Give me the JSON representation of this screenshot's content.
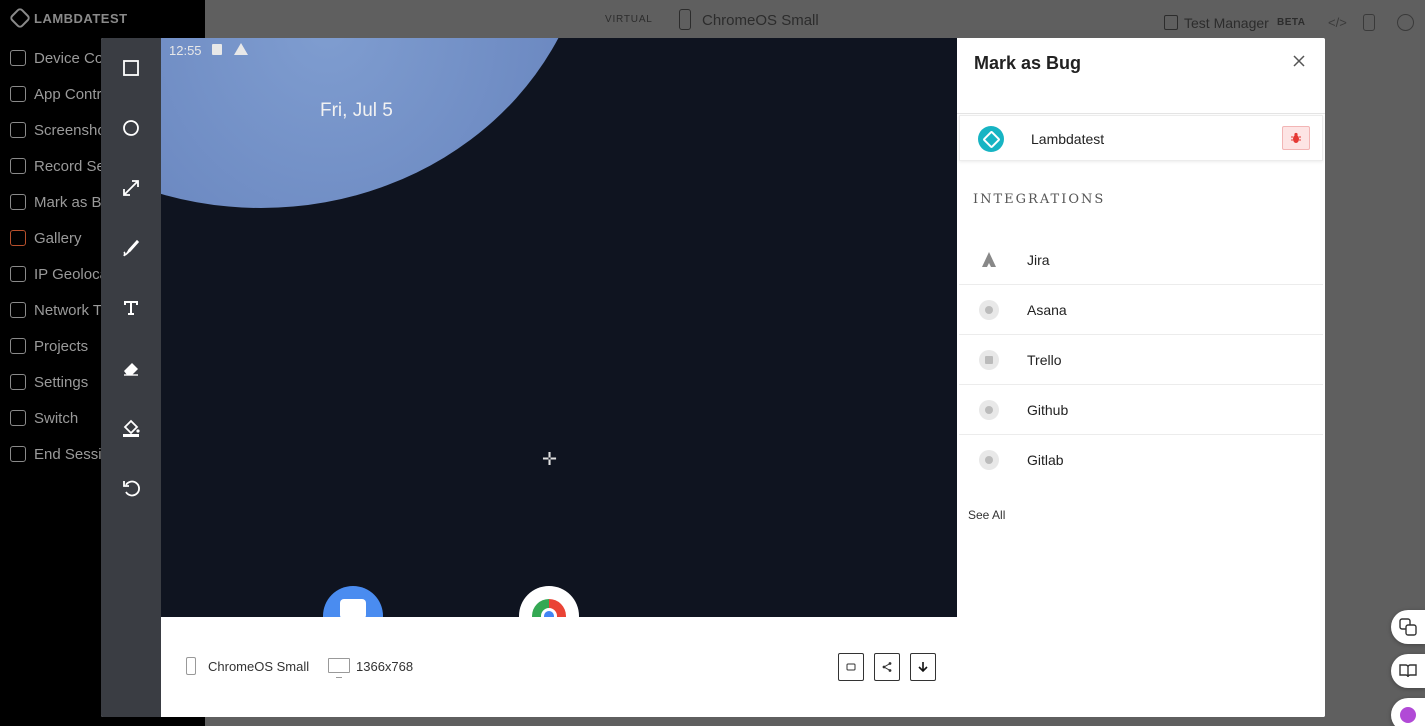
{
  "background": {
    "brand": "LAMBDATEST",
    "sidebar_items": [
      {
        "label": "Device Co",
        "icon": "phone-icon",
        "accent": false
      },
      {
        "label": "App Contr",
        "icon": "keyboard-icon",
        "accent": false
      },
      {
        "label": "Screensho",
        "icon": "camera-icon",
        "accent": false
      },
      {
        "label": "Record Se",
        "icon": "video-icon",
        "accent": false
      },
      {
        "label": "Mark as B",
        "icon": "bug-icon",
        "accent": false
      },
      {
        "label": "Gallery",
        "icon": "gallery-icon",
        "accent": true
      },
      {
        "label": "IP Geoloca",
        "icon": "globe-icon",
        "accent": false
      },
      {
        "label": "Network T",
        "icon": "antenna-icon",
        "accent": false
      },
      {
        "label": "Projects",
        "icon": "folder-icon",
        "accent": false
      },
      {
        "label": "Settings",
        "icon": "gear-icon",
        "accent": false
      },
      {
        "label": "Switch",
        "icon": "switch-icon",
        "accent": false
      },
      {
        "label": "End Sessi",
        "icon": "power-icon",
        "accent": false
      }
    ],
    "topbar": {
      "mode": "VIRTUAL",
      "device": "ChromeOS Small",
      "test_manager": "Test Manager",
      "beta": "BETA"
    }
  },
  "modal": {
    "tools": [
      {
        "name": "rectangle-tool",
        "icon": "square-icon",
        "active": true
      },
      {
        "name": "circle-tool",
        "icon": "circle-icon",
        "active": false
      },
      {
        "name": "arrow-tool",
        "icon": "arrow-diagonal-icon",
        "active": false
      },
      {
        "name": "pen-tool",
        "icon": "pen-icon",
        "active": false
      },
      {
        "name": "text-tool",
        "icon": "text-icon",
        "active": false
      },
      {
        "name": "eraser-tool",
        "icon": "eraser-icon",
        "active": false
      },
      {
        "name": "fill-tool",
        "icon": "paint-bucket-icon",
        "active": false
      },
      {
        "name": "undo-tool",
        "icon": "undo-icon",
        "active": false
      }
    ],
    "screen": {
      "status_time": "12:55",
      "date": "Fri, Jul 5"
    },
    "footer": {
      "device_name": "ChromeOS Small",
      "resolution": "1366x768"
    },
    "panel": {
      "title": "Mark as Bug",
      "lambdatest_label": "Lambdatest",
      "integrations_heading": "INTEGRATIONS",
      "integrations": [
        {
          "label": "Jira",
          "icon": "jira-icon"
        },
        {
          "label": "Asana",
          "icon": "asana-icon"
        },
        {
          "label": "Trello",
          "icon": "trello-icon"
        },
        {
          "label": "Github",
          "icon": "github-icon"
        },
        {
          "label": "Gitlab",
          "icon": "gitlab-icon"
        }
      ],
      "see_all": "See All"
    }
  },
  "colors": {
    "accent": "#17b4c3",
    "toolbar_bg": "#3a3d43",
    "overlay": "#5f5f5f",
    "bug_red": "#e53935"
  }
}
